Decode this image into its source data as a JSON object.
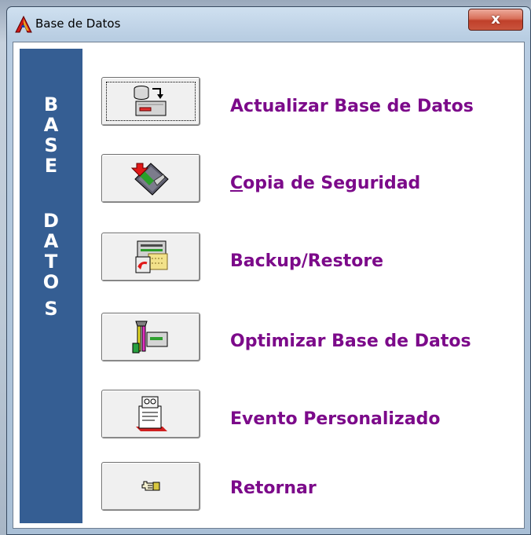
{
  "window": {
    "title": "Base de Datos",
    "close_glyph": "x",
    "icon": "app-logo-a-icon"
  },
  "banner": {
    "letters": [
      "B",
      "A",
      "S",
      "E",
      "D",
      "A",
      "T",
      "O",
      "S"
    ],
    "background": "#355e93",
    "text_color": "#ffffff"
  },
  "menu": {
    "label_color": "#7c0a8a",
    "items": [
      {
        "label": "Actualizar Base de Datos",
        "icon": "database-update-icon",
        "focused": true
      },
      {
        "label_underlined": "C",
        "label_rest": "opia de Seguridad",
        "icon": "floppy-backup-icon"
      },
      {
        "label": "Backup/Restore",
        "icon": "backup-restore-icon"
      },
      {
        "label": "Optimizar Base de Datos",
        "icon": "optimize-tools-icon"
      },
      {
        "label": "Evento Personalizado",
        "icon": "custom-event-printer-icon"
      },
      {
        "label": "Retornar",
        "icon": "pointing-hand-icon"
      }
    ]
  }
}
